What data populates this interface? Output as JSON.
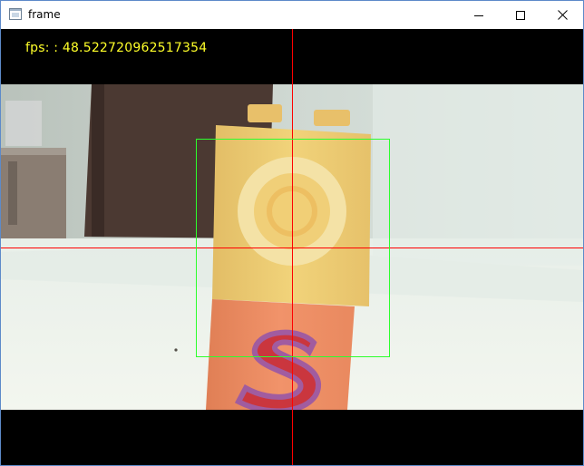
{
  "window": {
    "title": "frame",
    "icons": {
      "app": "app-window-icon",
      "minimize": "minimize-icon",
      "maximize": "maximize-icon",
      "close": "close-icon"
    }
  },
  "overlay": {
    "fps_text": "fps: : 48.522720962517354",
    "fps_color": "#ffff29",
    "crosshair_color": "#ff0000",
    "roi_color": "#2cff2c"
  }
}
